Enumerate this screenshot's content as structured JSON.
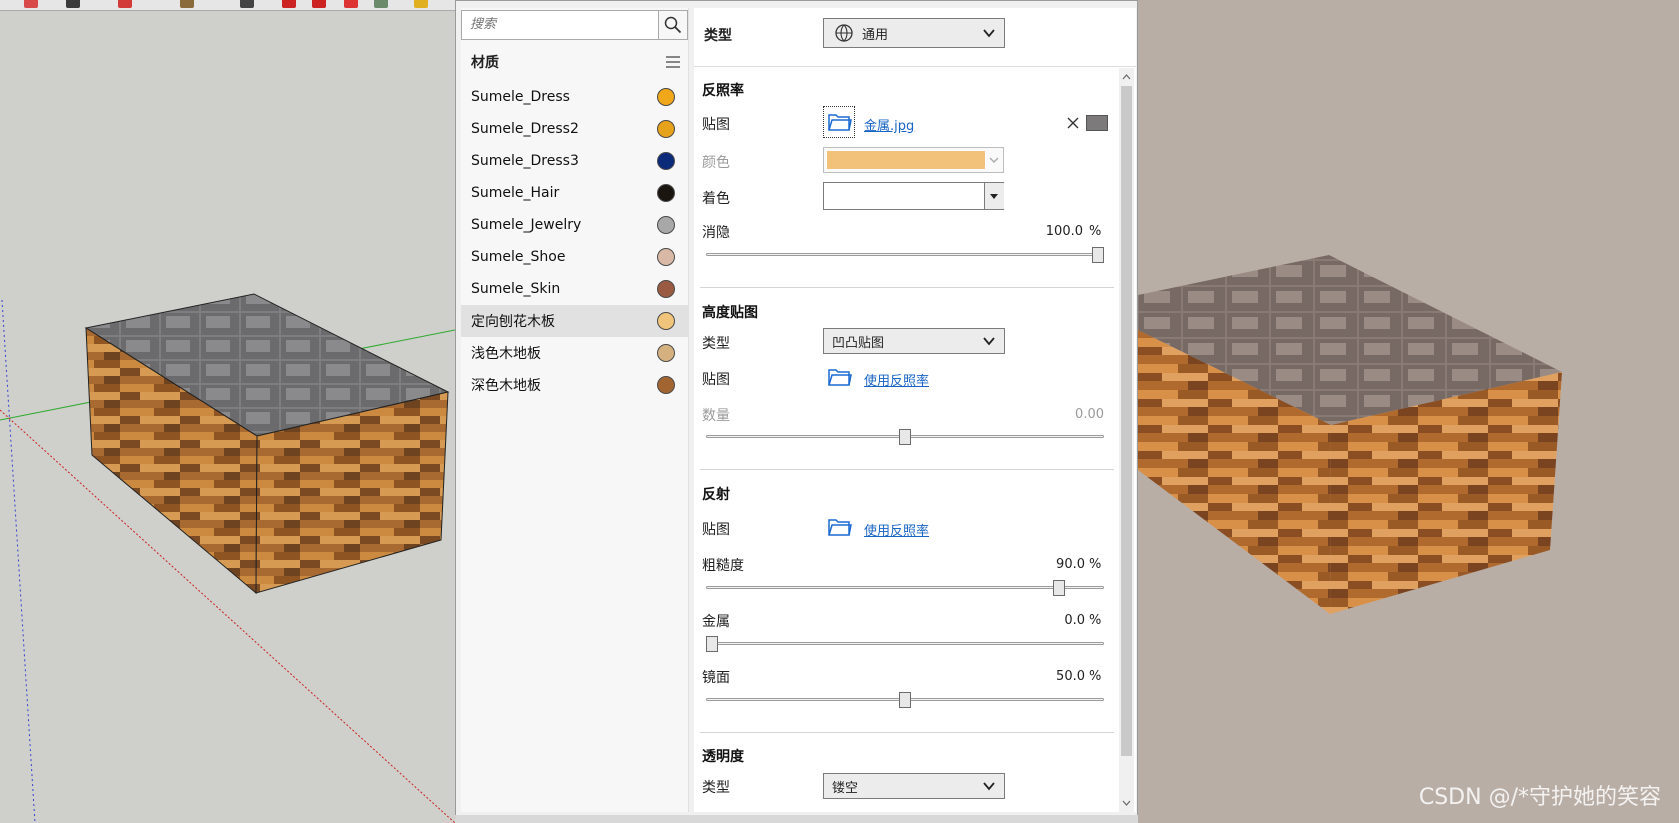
{
  "search": {
    "placeholder": "搜索"
  },
  "materials": {
    "title": "材质",
    "items": [
      {
        "label": "Sumele_Dress",
        "color": "#f0a81a"
      },
      {
        "label": "Sumele_Dress2",
        "color": "#e7a21b"
      },
      {
        "label": "Sumele_Dress3",
        "color": "#0b2a7a"
      },
      {
        "label": "Sumele_Hair",
        "color": "#1b1510"
      },
      {
        "label": "Sumele_Jewelry",
        "color": "#a8a8a8"
      },
      {
        "label": "Sumele_Shoe",
        "color": "#d9b9a6"
      },
      {
        "label": "Sumele_Skin",
        "color": "#9a5a42"
      },
      {
        "label": "定向刨花木板",
        "color": "#f0c47a",
        "selected": true
      },
      {
        "label": "浅色木地板",
        "color": "#d6b180"
      },
      {
        "label": "深色木地板",
        "color": "#a26532"
      }
    ]
  },
  "props": {
    "type_label": "类型",
    "type_value": "通用",
    "albedo": {
      "title": "反照率",
      "map_label": "贴图",
      "map_file": "金属.jpg",
      "color_label": "颜色",
      "color_value": "#f2c27a",
      "tint_label": "着色",
      "opacity_label": "消隐",
      "opacity_value": "100.0",
      "opacity_fraction": 1.0
    },
    "height": {
      "title": "高度贴图",
      "type_label": "类型",
      "type_value": "凹凸贴图",
      "map_label": "贴图",
      "map_link": "使用反照率",
      "amount_label": "数量",
      "amount_value": "0.00",
      "amount_fraction": 0.5
    },
    "reflection": {
      "title": "反射",
      "map_label": "贴图",
      "map_link": "使用反照率",
      "roughness_label": "粗糙度",
      "roughness_value": "90.0",
      "roughness_fraction": 0.9,
      "metal_label": "金属",
      "metal_value": "0.0",
      "metal_fraction": 0.0,
      "specular_label": "镜面",
      "specular_value": "50.0",
      "specular_fraction": 0.5
    },
    "transparency": {
      "title": "透明度",
      "type_label": "类型",
      "type_value": "镂空"
    },
    "percent_sign": "%"
  },
  "watermark": "CSDN @/*守护她的笑容",
  "icons": {
    "search": "search-icon",
    "menu": "hamburger-menu-icon",
    "folder": "folder-icon",
    "close": "close-icon",
    "globe": "globe-icon",
    "chevron": "chevron-down-icon"
  }
}
